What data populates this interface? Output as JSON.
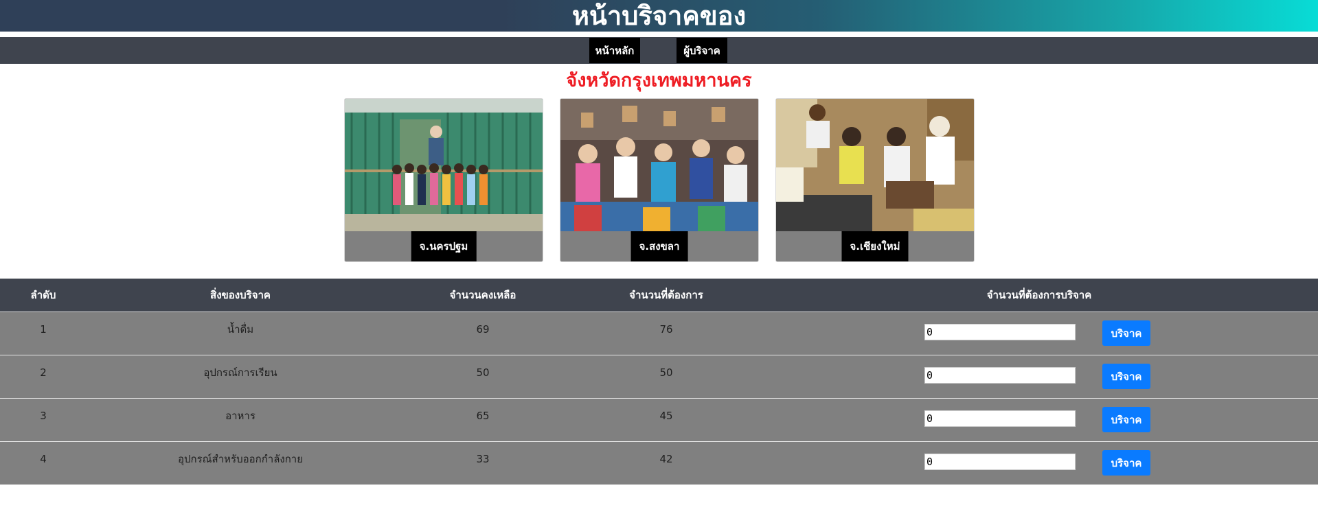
{
  "header": {
    "title": "หน้าบริจาคของ"
  },
  "nav": {
    "home_label": "หน้าหลัก",
    "donors_label": "ผู้บริจาค"
  },
  "province": {
    "title": "จังหวัดกรุงเทพมหานคร"
  },
  "cards": [
    {
      "label": "จ.นครปฐม"
    },
    {
      "label": "จ.สงขลา"
    },
    {
      "label": "จ.เชียงใหม่"
    }
  ],
  "table": {
    "headers": {
      "index": "ลำดับ",
      "item": "สิ่งของบริจาค",
      "remaining": "จำนวนคงเหลือ",
      "needed": "จำนวนที่ต้องการ",
      "donate_amount": "จำนวนที่ต้องการบริจาค"
    },
    "rows": [
      {
        "index": "1",
        "item": "น้ำดื่ม",
        "remaining": "69",
        "needed": "76",
        "input_value": "0",
        "button": "บริจาค"
      },
      {
        "index": "2",
        "item": "อุปกรณ์การเรียน",
        "remaining": "50",
        "needed": "50",
        "input_value": "0",
        "button": "บริจาค"
      },
      {
        "index": "3",
        "item": "อาหาร",
        "remaining": "65",
        "needed": "45",
        "input_value": "0",
        "button": "บริจาค"
      },
      {
        "index": "4",
        "item": "อุปกรณ์สำหรับออกกำลังกาย",
        "remaining": "33",
        "needed": "42",
        "input_value": "0",
        "button": "บริจาค"
      }
    ]
  },
  "colors": {
    "navbar": "#3f444e",
    "province_title": "#ee1d24",
    "table_row": "#808080",
    "donate_button": "#0a7bff"
  }
}
